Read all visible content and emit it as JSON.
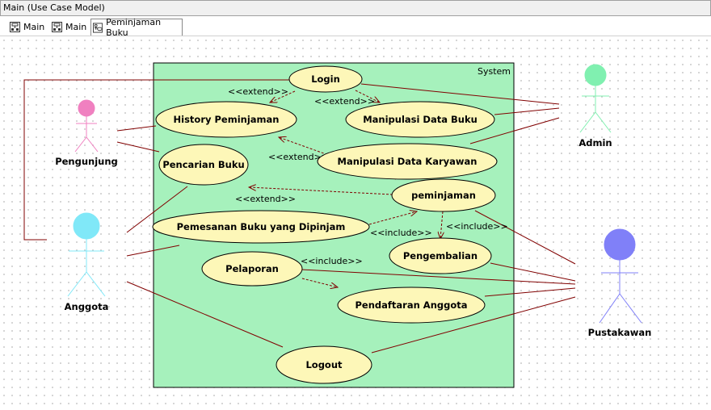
{
  "window": {
    "title": "Main (Use Case Model)"
  },
  "tabs": [
    {
      "label": "Main",
      "icon": "diagram-icon"
    },
    {
      "label": "Main",
      "icon": "diagram-icon"
    },
    {
      "label": "Peminjaman Buku",
      "icon": "usecase-diagram-icon",
      "active": true
    }
  ],
  "diagram": {
    "system_label": "System",
    "actors": {
      "pengunjung": {
        "name": "Pengunjung",
        "color": "#f080c0"
      },
      "anggota": {
        "name": "Anggota",
        "color": "#80e8f8"
      },
      "admin": {
        "name": "Admin",
        "color": "#80f0b0"
      },
      "pustakawan": {
        "name": "Pustakawan",
        "color": "#8080f8"
      }
    },
    "use_cases": {
      "login": "Login",
      "history": "History Peminjaman",
      "manipulasi_buku": "Manipulasi Data Buku",
      "pencarian": "Pencarian Buku",
      "manipulasi_karyawan": "Manipulasi Data Karyawan",
      "peminjaman": "peminjaman",
      "pemesanan": "Pemesanan Buku yang Dipinjam",
      "pengembalian": "Pengembalian",
      "pelaporan": "Pelaporan",
      "pendaftaran": "Pendaftaran Anggota",
      "logout": "Logout"
    },
    "stereotypes": {
      "extend1": "<<extend>>",
      "extend2": "<<extend>>",
      "extend3": "<<extend>>",
      "extend4": "<<extend>>",
      "include1": "<<include>>",
      "include2": "<<include>>",
      "include3": "<<include>>"
    },
    "colors": {
      "system_fill": "#a6f1bc",
      "usecase_fill": "#fdf7b8",
      "line": "#800000"
    }
  }
}
